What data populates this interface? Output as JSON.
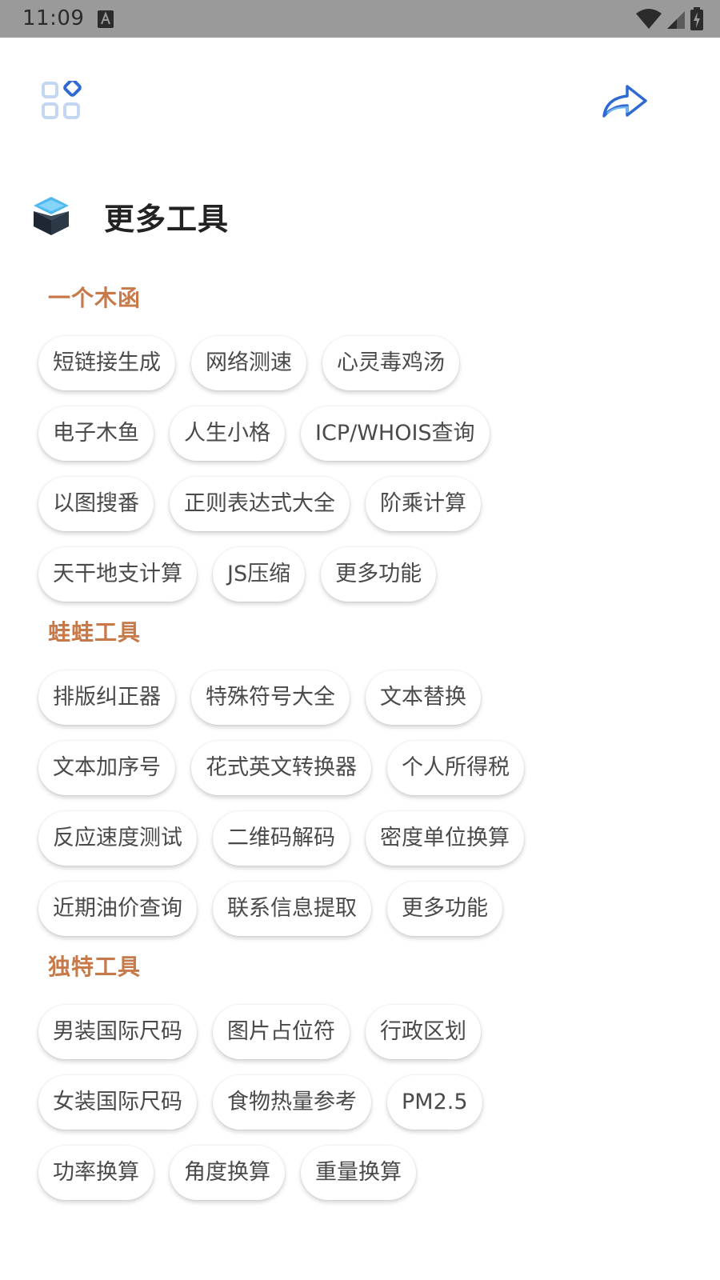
{
  "status_bar": {
    "time": "11:09",
    "notification_icon": "a-icon",
    "icons": [
      "wifi-icon",
      "signal-icon",
      "battery-charging-icon"
    ]
  },
  "colors": {
    "status_bar_bg": "#9a9a9a",
    "section_title": "#c8794a",
    "accent_blue": "#2e6ad1",
    "chip_text": "#4a4a4a"
  },
  "top_bar": {
    "left_icon": "apps-grid-icon",
    "right_icon": "share-arrow-icon"
  },
  "page": {
    "title": "更多工具",
    "title_icon": "cube-box-icon"
  },
  "sections": [
    {
      "title": "一个木函",
      "chips": [
        "短链接生成",
        "网络测速",
        "心灵毒鸡汤",
        "电子木鱼",
        "人生小格",
        "ICP/WHOIS查询",
        "以图搜番",
        "正则表达式大全",
        "阶乘计算",
        "天干地支计算",
        "JS压缩",
        "更多功能"
      ]
    },
    {
      "title": "蛙蛙工具",
      "chips": [
        "排版纠正器",
        "特殊符号大全",
        "文本替换",
        "文本加序号",
        "花式英文转换器",
        "个人所得税",
        "反应速度测试",
        "二维码解码",
        "密度单位换算",
        "近期油价查询",
        "联系信息提取",
        "更多功能"
      ]
    },
    {
      "title": "独特工具",
      "chips": [
        "男装国际尺码",
        "图片占位符",
        "行政区划",
        "女装国际尺码",
        "食物热量参考",
        "PM2.5",
        "功率换算",
        "角度换算",
        "重量换算"
      ]
    }
  ]
}
